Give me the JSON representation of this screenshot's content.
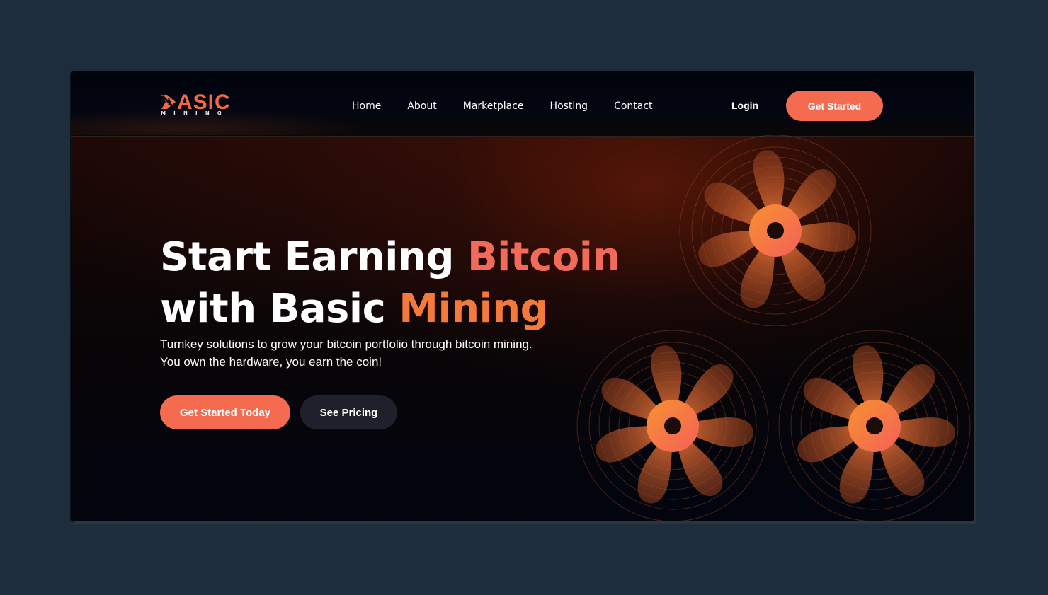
{
  "brand": {
    "logo_word": "ASIC",
    "logo_sub": "MINING",
    "colors": {
      "accent": "#f46b50",
      "accent_gradient_end": "#f47a3c",
      "background": "#1e2d3b",
      "panel": "#02050f"
    }
  },
  "nav": {
    "links": [
      {
        "label": "Home"
      },
      {
        "label": "About"
      },
      {
        "label": "Marketplace"
      },
      {
        "label": "Hosting"
      },
      {
        "label": "Contact"
      }
    ],
    "login_label": "Login",
    "get_started_label": "Get Started"
  },
  "hero": {
    "headline_line1_white": "Start Earning",
    "headline_line1_accent": "Bitcoin",
    "headline_line2_white": "with Basic",
    "headline_line2_accent": "Mining",
    "subtitle": "Turnkey solutions to grow your bitcoin portfolio through bitcoin mining. You own the hardware, you earn the coin!",
    "primary_cta": "Get Started Today",
    "secondary_cta": "See Pricing"
  },
  "decor": {
    "fan_icon": "mining-fan-icon",
    "fan_count": 3
  }
}
